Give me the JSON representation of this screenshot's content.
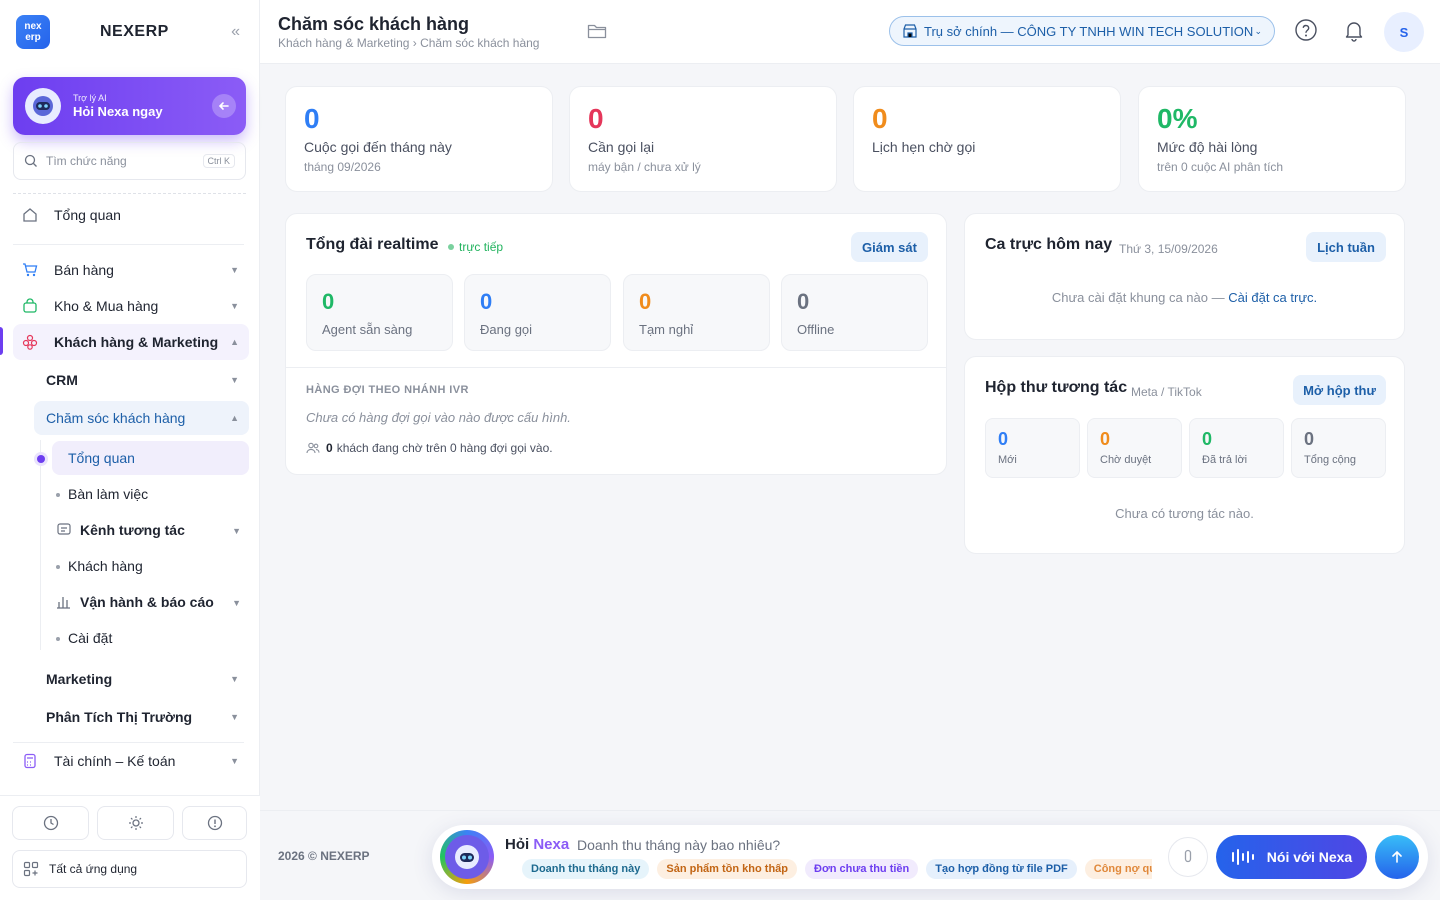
{
  "sidebar": {
    "logo_top": "nex",
    "logo_bottom": "erp",
    "brand": "NEXERP",
    "ai": {
      "small": "Trợ lý AI",
      "big": "Hỏi Nexa ngay"
    },
    "search_placeholder": "Tìm chức năng",
    "search_shortcut": "Ctrl K",
    "items": {
      "overview": "Tổng quan",
      "sales": "Bán hàng",
      "inventory": "Kho & Mua hàng",
      "crm_marketing": "Khách hàng & Marketing",
      "crm": "CRM",
      "care": "Chăm sóc khách hàng",
      "care_overview": "Tổng quan",
      "workspace": "Bàn làm việc",
      "channels": "Kênh tương tác",
      "customers": "Khách hàng",
      "ops": "Vận hành & báo cáo",
      "settings": "Cài đặt",
      "marketing": "Marketing",
      "market": "Phân Tích Thị Trường",
      "finance": "Tài chính – Kế toán"
    },
    "all_apps": "Tất cả ứng dụng"
  },
  "header": {
    "title": "Chăm sóc khách hàng",
    "breadcrumb": "Khách hàng & Marketing › Chăm sóc khách hàng",
    "branch": "Trụ sở chính — CÔNG TY TNHH WIN TECH SOLUTION",
    "avatar": "S"
  },
  "stats": [
    {
      "value": "0",
      "label": "Cuộc gọi đến tháng này",
      "sub": "tháng 09/2026",
      "color": "#2f7ef5"
    },
    {
      "value": "0",
      "label": "Cần gọi lại",
      "sub": "máy bận / chưa xử lý",
      "color": "#e5365a"
    },
    {
      "value": "0",
      "label": "Lịch hẹn chờ gọi",
      "sub": "",
      "color": "#f08c1c"
    },
    {
      "value": "0%",
      "label": "Mức độ hài lòng",
      "sub": "trên 0 cuộc AI phân tích",
      "color": "#1fb866"
    }
  ],
  "realtime": {
    "title": "Tổng đài realtime",
    "live": "trực tiếp",
    "button": "Giám sát",
    "tiles": [
      {
        "value": "0",
        "label": "Agent sẵn sàng",
        "color": "#1fb866"
      },
      {
        "value": "0",
        "label": "Đang gọi",
        "color": "#2f7ef5"
      },
      {
        "value": "0",
        "label": "Tạm nghỉ",
        "color": "#f08c1c"
      },
      {
        "value": "0",
        "label": "Offline",
        "color": "#6b7280"
      }
    ],
    "queue_heading": "HÀNG ĐỢI THEO NHÁNH IVR",
    "queue_empty": "Chưa có hàng đợi gọi vào nào được cấu hình.",
    "waiting_count": "0",
    "waiting_text": "khách đang chờ trên 0 hàng đợi gọi vào."
  },
  "shift": {
    "title": "Ca trực hôm nay",
    "date": "Thứ 3, 15/09/2026",
    "button": "Lịch tuần",
    "empty": "Chưa cài đặt khung ca nào — ",
    "link": "Cài đặt ca trực."
  },
  "inbox": {
    "title": "Hộp thư tương tác",
    "sub": "Meta / TikTok",
    "button": "Mở hộp thư",
    "tiles": [
      {
        "value": "0",
        "label": "Mới",
        "color": "#2f7ef5"
      },
      {
        "value": "0",
        "label": "Chờ duyệt",
        "color": "#f08c1c"
      },
      {
        "value": "0",
        "label": "Đã trả lời",
        "color": "#1fb866"
      },
      {
        "value": "0",
        "label": "Tổng cộng",
        "color": "#6b7280"
      }
    ],
    "empty": "Chưa có tương tác nào."
  },
  "footer": {
    "copyright": "2026 © NEXERP",
    "ask_prefix": "Hỏi",
    "ask_brand": "Nexa",
    "ask_placeholder": "Doanh thu tháng này bao nhiêu?",
    "chips": [
      {
        "text": "Doanh thu tháng này",
        "bg": "#e6f4fb",
        "fg": "#1d6a8f"
      },
      {
        "text": "Sản phẩm tồn kho thấp",
        "bg": "#fdefe1",
        "fg": "#c26514"
      },
      {
        "text": "Đơn chưa thu tiền",
        "bg": "#f1ebfd",
        "fg": "#6d3ef0"
      },
      {
        "text": "Tạo hợp đồng từ file PDF",
        "bg": "#e6f0fc",
        "fg": "#1d5fa8"
      },
      {
        "text": "Công nợ quá hạn",
        "bg": "#fdefe1",
        "fg": "#e0883a"
      }
    ],
    "talk": "Nói với Nexa"
  }
}
